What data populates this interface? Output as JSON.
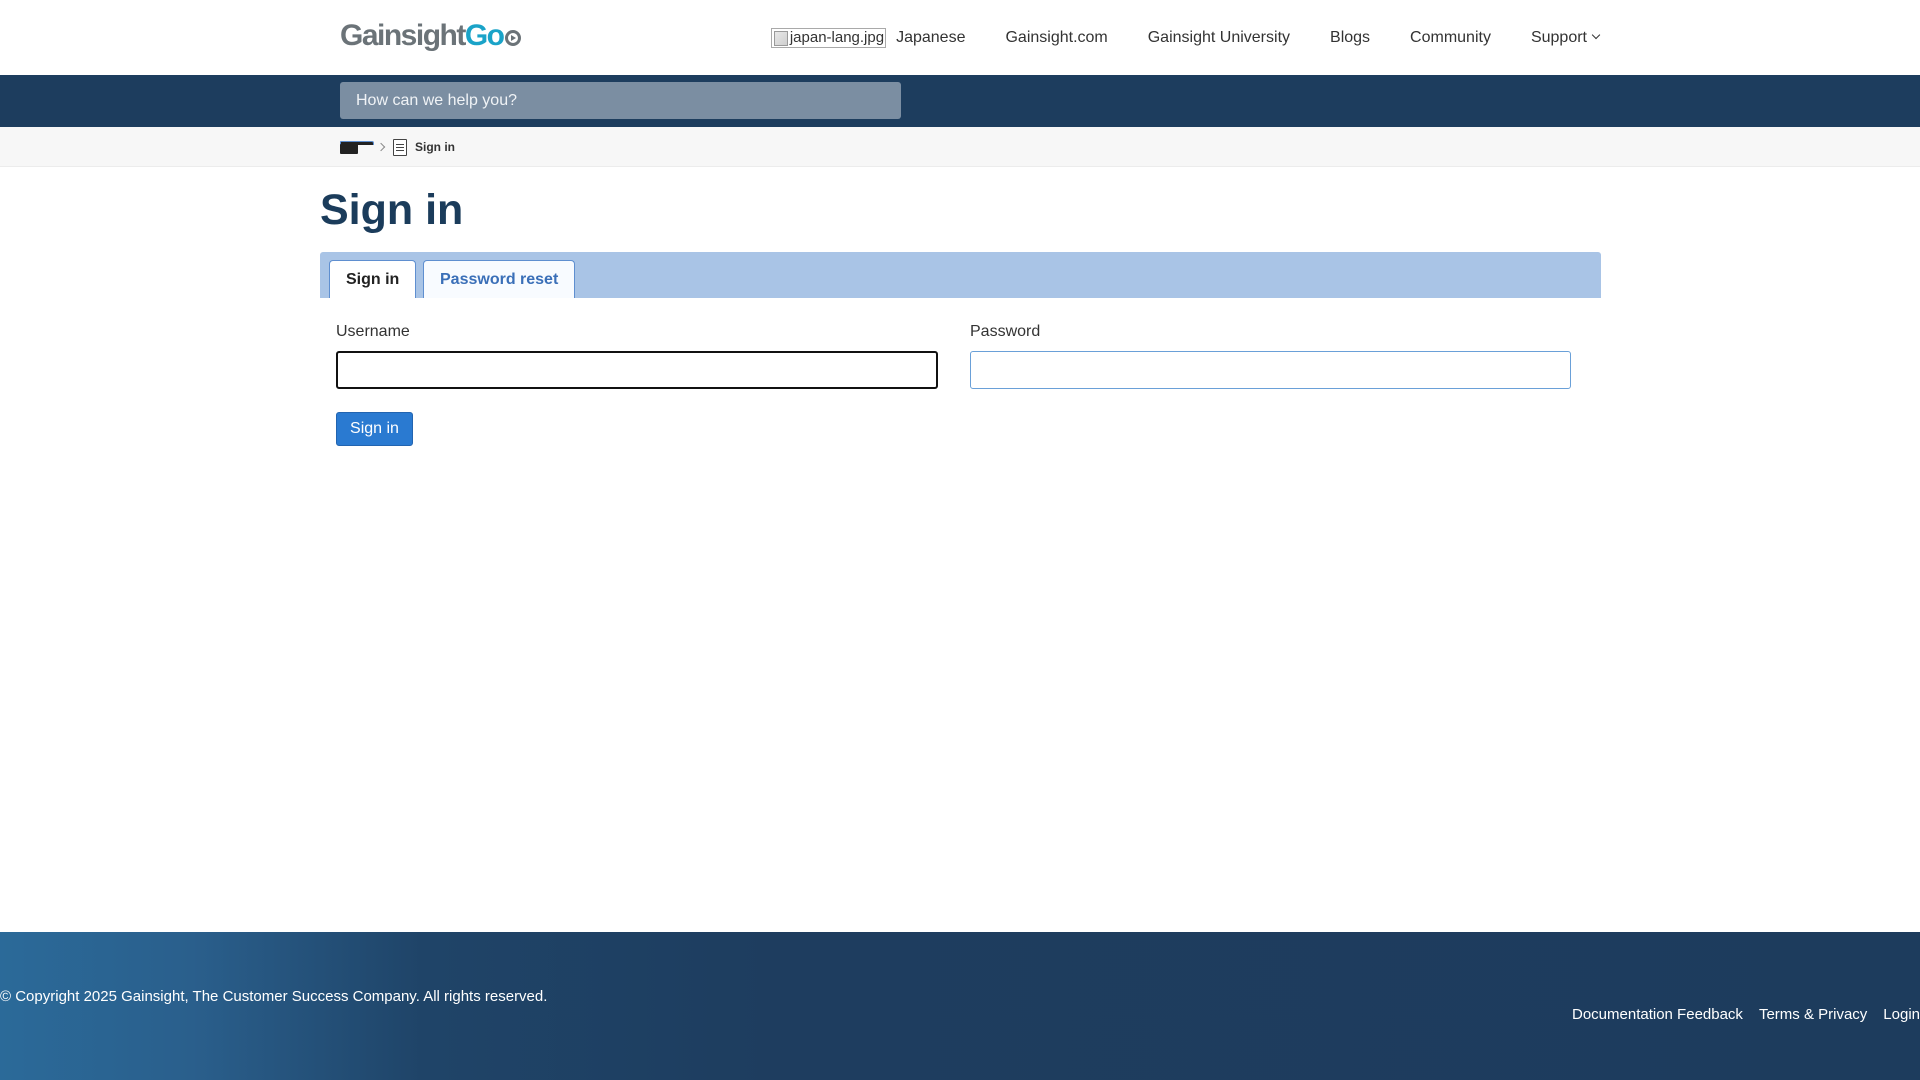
{
  "header": {
    "logo_text_a": "Gainsight",
    "logo_text_b": "Go",
    "nav": {
      "japanese_img_alt": "japan-lang.jpg",
      "japanese": "Japanese",
      "gainsight_com": "Gainsight.com",
      "university": "Gainsight University",
      "blogs": "Blogs",
      "community": "Community",
      "support": "Support"
    }
  },
  "search": {
    "placeholder": "How can we help you?",
    "value": ""
  },
  "breadcrumb": {
    "current": "Sign in"
  },
  "main": {
    "title": "Sign in",
    "tabs": {
      "sign_in": "Sign in",
      "password_reset": "Password reset"
    },
    "username_label": "Username",
    "username_value": "",
    "password_label": "Password",
    "password_value": "",
    "submit_label": "Sign in"
  },
  "footer": {
    "copyright": "© Copyright 2025 Gainsight, The Customer Success Company. All rights reserved.",
    "links": {
      "feedback": "Documentation Feedback",
      "terms": "Terms & Privacy",
      "login": "Login"
    }
  },
  "colors": {
    "header_band": "#1d3d5e",
    "title": "#1b3c5b",
    "tabs_bar": "#a9c4e6",
    "button": "#2a7ad1",
    "logo_go": "#1aa3c8"
  }
}
